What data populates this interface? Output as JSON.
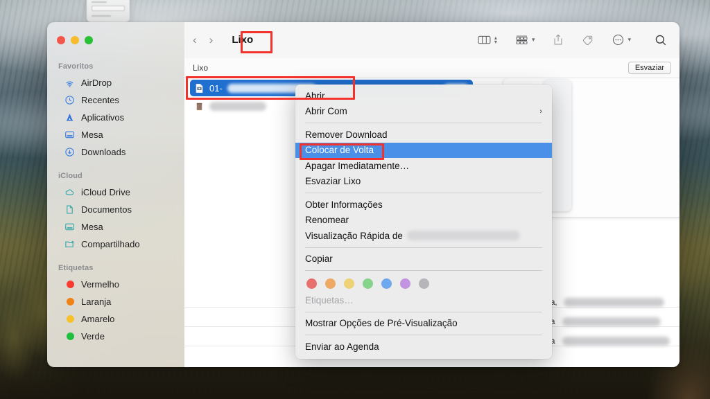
{
  "window": {
    "title": "Lixo",
    "traffic_lights": [
      "close",
      "minimize",
      "zoom"
    ],
    "accent_color": "#4a90e8",
    "selection_color": "#1f6fd0",
    "annotation_color": "#f4322c"
  },
  "toolbar": {
    "back_label": "‹",
    "forward_label": "›",
    "view_icon": "column-view-icon",
    "group_icon": "group-by-icon",
    "share_icon": "share-icon",
    "tag_icon": "tag-icon",
    "more_icon": "more-actions-icon",
    "search_icon": "search-icon"
  },
  "pathbar": {
    "location": "Lixo",
    "empty_button": "Esvaziar"
  },
  "sidebar": {
    "sections": [
      {
        "title": "Favoritos",
        "items": [
          {
            "label": "AirDrop",
            "icon": "airdrop-icon",
            "color": "#3b7fe0"
          },
          {
            "label": "Recentes",
            "icon": "clock-icon",
            "color": "#3b7fe0"
          },
          {
            "label": "Aplicativos",
            "icon": "applications-icon",
            "color": "#2f6fd8"
          },
          {
            "label": "Mesa",
            "icon": "desktop-icon",
            "color": "#3b7fe0"
          },
          {
            "label": "Downloads",
            "icon": "download-icon",
            "color": "#3b7fe0"
          }
        ]
      },
      {
        "title": "iCloud",
        "items": [
          {
            "label": "iCloud Drive",
            "icon": "cloud-icon",
            "color": "#3aa8ad"
          },
          {
            "label": "Documentos",
            "icon": "document-icon",
            "color": "#3aa8ad"
          },
          {
            "label": "Mesa",
            "icon": "desktop-icon",
            "color": "#3aa8ad"
          },
          {
            "label": "Compartilhado",
            "icon": "shared-folder-icon",
            "color": "#3aa8ad"
          }
        ]
      },
      {
        "title": "Etiquetas",
        "items": [
          {
            "label": "Vermelho",
            "icon": "tag-dot-icon",
            "color": "#fa3b30"
          },
          {
            "label": "Laranja",
            "icon": "tag-dot-icon",
            "color": "#f08215"
          },
          {
            "label": "Amarelo",
            "icon": "tag-dot-icon",
            "color": "#f6c12b"
          },
          {
            "label": "Verde",
            "icon": "tag-dot-icon",
            "color": "#21bf3e"
          }
        ]
      }
    ]
  },
  "filelist": {
    "rows": [
      {
        "name_visible": "01-",
        "selected": true,
        "icon": "file-icon",
        "redacted": true
      },
      {
        "name_visible": "",
        "selected": false,
        "icon": "trash-file-icon",
        "redacted": true
      }
    ],
    "date_column": [
      {
        "text": "feira,"
      },
      {
        "text": "feira"
      },
      {
        "text": "feira"
      }
    ]
  },
  "context_menu": {
    "groups": [
      {
        "items": [
          {
            "label": "Abrir",
            "type": "item"
          },
          {
            "label": "Abrir Com",
            "type": "submenu",
            "arrow": "›"
          }
        ]
      },
      {
        "items": [
          {
            "label": "Remover Download",
            "type": "item"
          },
          {
            "label": "Colocar de Volta",
            "type": "item",
            "highlighted": true
          },
          {
            "label": "Apagar Imediatamente…",
            "type": "item"
          },
          {
            "label": "Esvaziar Lixo",
            "type": "item"
          }
        ]
      },
      {
        "items": [
          {
            "label": "Obter Informações",
            "type": "item"
          },
          {
            "label": "Renomear",
            "type": "item"
          },
          {
            "label": "Visualização Rápida de",
            "type": "item-redacted"
          }
        ]
      },
      {
        "items": [
          {
            "label": "Copiar",
            "type": "item"
          }
        ]
      },
      {
        "items": [
          {
            "label": "Etiquetas…",
            "type": "placeholder"
          }
        ],
        "tag_colors": [
          "#e8716f",
          "#eea965",
          "#efd275",
          "#86d48c",
          "#6ea8ee",
          "#c293e0",
          "#b6b6ba"
        ]
      },
      {
        "items": [
          {
            "label": "Mostrar Opções de Pré-Visualização",
            "type": "item"
          }
        ]
      },
      {
        "items": [
          {
            "label": "Enviar ao Agenda",
            "type": "item"
          }
        ]
      }
    ]
  },
  "annotations": [
    {
      "name": "title-highlight",
      "target": "Lixo"
    },
    {
      "name": "selected-row-highlight",
      "target": "01-"
    },
    {
      "name": "menu-item-highlight",
      "target": "Colocar de Volta"
    }
  ]
}
